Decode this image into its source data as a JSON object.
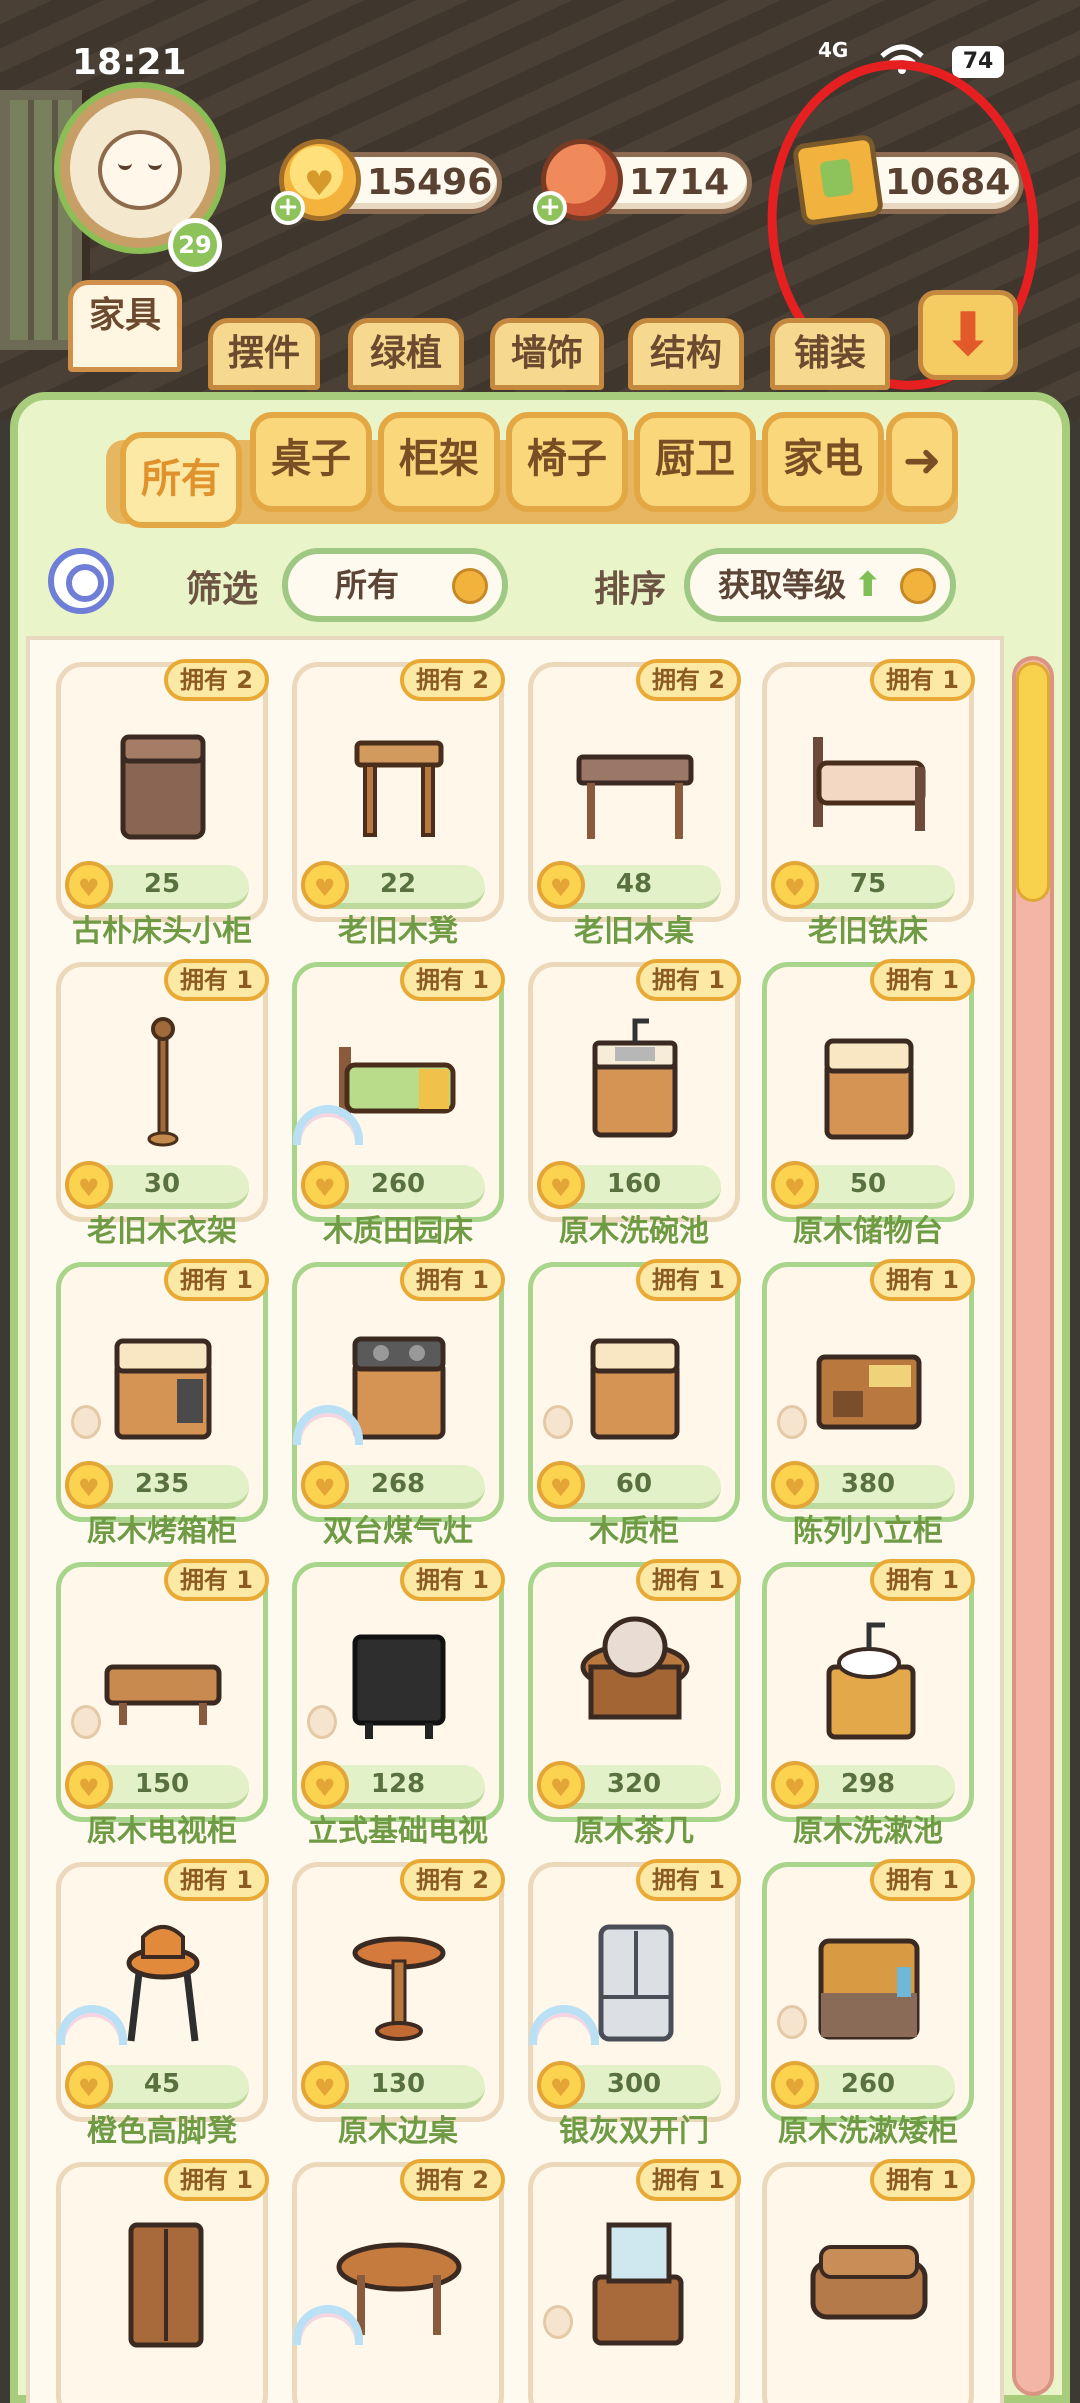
{
  "status": {
    "time": "18:21",
    "network": "4G",
    "battery": "74"
  },
  "player": {
    "level": "29"
  },
  "currencies": [
    {
      "icon": "heart-coin-icon",
      "value": "15496",
      "has_plus": true
    },
    {
      "icon": "fruit-icon",
      "value": "1714",
      "has_plus": true
    },
    {
      "icon": "manual-book-icon",
      "value": "10684",
      "has_plus": false
    }
  ],
  "category_tabs": [
    "家具",
    "摆件",
    "绿植",
    "墙饰",
    "结构",
    "铺装"
  ],
  "sub_tabs": [
    "所有",
    "桌子",
    "柜架",
    "椅子",
    "厨卫",
    "家电"
  ],
  "filter": {
    "label": "筛选",
    "value": "所有"
  },
  "sort": {
    "label": "排序",
    "value": "获取等级"
  },
  "items": [
    {
      "name": "古朴床头小柜",
      "owned": "拥有 2",
      "price": "25",
      "art": "cabinet-brown"
    },
    {
      "name": "老旧木凳",
      "owned": "拥有 2",
      "price": "22",
      "art": "stool"
    },
    {
      "name": "老旧木桌",
      "owned": "拥有 2",
      "price": "48",
      "art": "desk"
    },
    {
      "name": "老旧铁床",
      "owned": "拥有 1",
      "price": "75",
      "art": "bed-iron"
    },
    {
      "name": "老旧木衣架",
      "owned": "拥有 1",
      "price": "30",
      "art": "coat-rack"
    },
    {
      "name": "木质田园床",
      "owned": "拥有 1",
      "price": "260",
      "art": "bed-green"
    },
    {
      "name": "原木洗碗池",
      "owned": "拥有 1",
      "price": "160",
      "art": "sink"
    },
    {
      "name": "原木储物台",
      "owned": "拥有 1",
      "price": "50",
      "art": "counter"
    },
    {
      "name": "原木烤箱柜",
      "owned": "拥有 1",
      "price": "235",
      "art": "oven"
    },
    {
      "name": "双台煤气灶",
      "owned": "拥有 1",
      "price": "268",
      "art": "stove"
    },
    {
      "name": "木质柜",
      "owned": "拥有 1",
      "price": "60",
      "art": "counter"
    },
    {
      "name": "陈列小立柜",
      "owned": "拥有 1",
      "price": "380",
      "art": "shelf"
    },
    {
      "name": "原木电视柜",
      "owned": "拥有 1",
      "price": "150",
      "art": "tv-stand"
    },
    {
      "name": "立式基础电视",
      "owned": "拥有 1",
      "price": "128",
      "art": "tv"
    },
    {
      "name": "原木茶几",
      "owned": "拥有 1",
      "price": "320",
      "art": "tea-table"
    },
    {
      "name": "原木洗漱池",
      "owned": "拥有 1",
      "price": "298",
      "art": "vanity"
    },
    {
      "name": "橙色高脚凳",
      "owned": "拥有 1",
      "price": "45",
      "art": "bar-stool"
    },
    {
      "name": "原木边桌",
      "owned": "拥有 2",
      "price": "130",
      "art": "side-table"
    },
    {
      "name": "银灰双开门",
      "owned": "拥有 1",
      "price": "300",
      "art": "fridge"
    },
    {
      "name": "原木洗漱矮柜",
      "owned": "拥有 1",
      "price": "260",
      "art": "wash-cabinet"
    },
    {
      "name": "",
      "owned": "拥有 1",
      "price": "",
      "art": "wardrobe"
    },
    {
      "name": "",
      "owned": "拥有 2",
      "price": "",
      "art": "oval-table"
    },
    {
      "name": "",
      "owned": "拥有 1",
      "price": "",
      "art": "dresser"
    },
    {
      "name": "",
      "owned": "拥有 1",
      "price": "",
      "art": "sofa"
    }
  ]
}
